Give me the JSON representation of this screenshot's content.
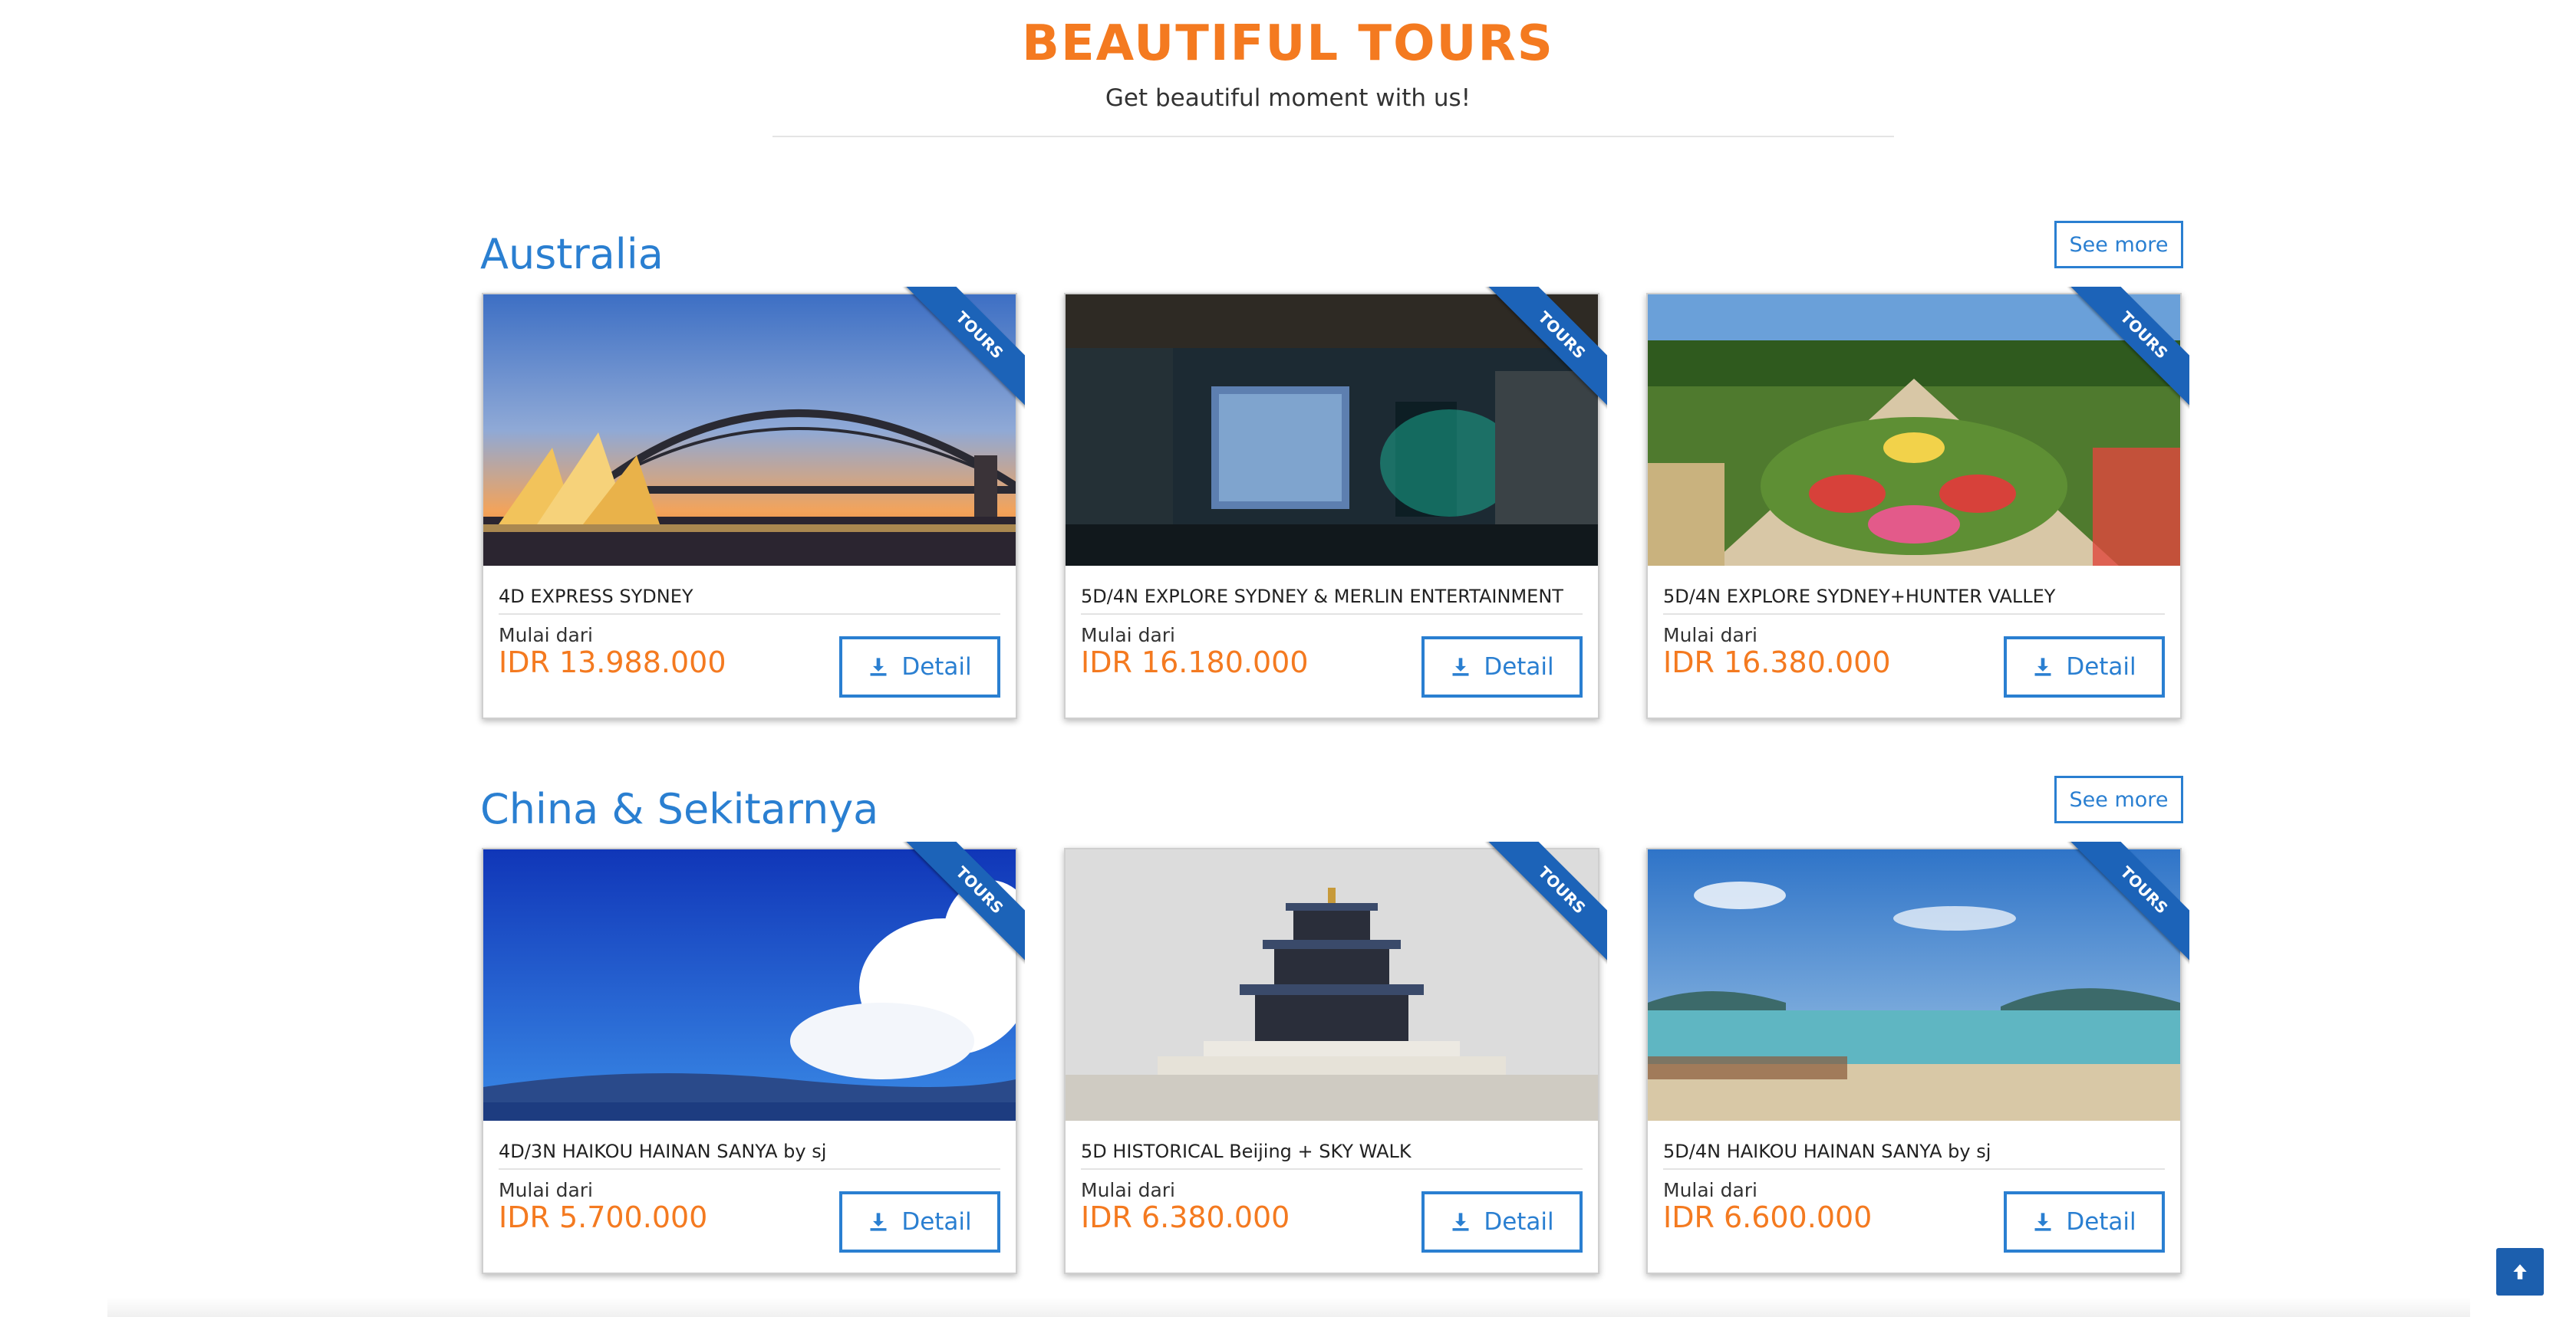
{
  "hero": {
    "title": "BEAUTIFUL TOURS",
    "subtitle": "Get beautiful moment with us!"
  },
  "sections": [
    {
      "title": "Australia",
      "see_more": "See more",
      "cards": [
        {
          "ribbon": "TOURS",
          "name": "4D EXPRESS SYDNEY",
          "from_label": "Mulai dari",
          "price": "IDR 13.988.000",
          "detail": "Detail",
          "image": "sydney-opera-house-harbour-bridge"
        },
        {
          "ribbon": "TOURS",
          "name": "5D/4N EXPLORE SYDNEY & MERLIN ENTERTAINMENT",
          "from_label": "Mulai dari",
          "price": "IDR 16.180.000",
          "detail": "Detail",
          "image": "aquarium-cave-interior"
        },
        {
          "ribbon": "TOURS",
          "name": "5D/4N EXPLORE SYDNEY+HUNTER VALLEY",
          "from_label": "Mulai dari",
          "price": "IDR 16.380.000",
          "detail": "Detail",
          "image": "hunter-valley-gardens"
        }
      ]
    },
    {
      "title": "China & Sekitarnya",
      "see_more": "See more",
      "cards": [
        {
          "ribbon": "TOURS",
          "name": "4D/3N HAIKOU HAINAN SANYA by sj",
          "from_label": "Mulai dari",
          "price": "IDR 5.700.000",
          "detail": "Detail",
          "image": "blue-sky-clouds-sea"
        },
        {
          "ribbon": "TOURS",
          "name": "5D HISTORICAL Beijing + SKY WALK",
          "from_label": "Mulai dari",
          "price": "IDR 6.380.000",
          "detail": "Detail",
          "image": "temple-of-heaven"
        },
        {
          "ribbon": "TOURS",
          "name": "5D/4N HAIKOU HAINAN SANYA by sj",
          "from_label": "Mulai dari",
          "price": "IDR 6.600.000",
          "detail": "Detail",
          "image": "sanya-beach"
        }
      ]
    }
  ],
  "icons": {
    "detail_icon": "download-icon",
    "back_to_top": "arrow-up-icon"
  },
  "colors": {
    "accent_orange": "#f47a20",
    "brand_blue": "#2a7fd1",
    "ribbon_blue": "#1c63b8"
  }
}
